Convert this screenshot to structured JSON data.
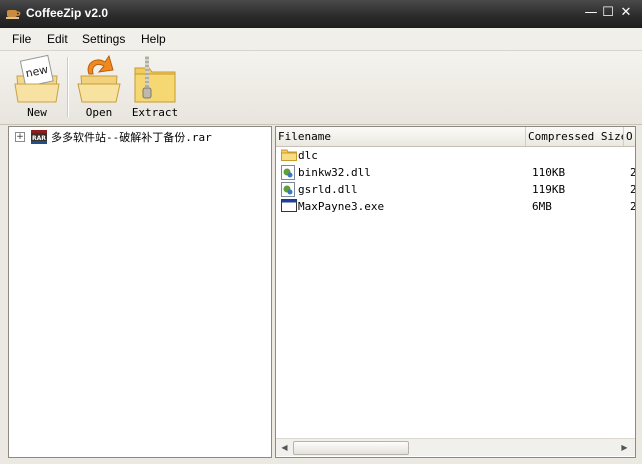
{
  "window": {
    "title": "CoffeeZip v2.0",
    "controls": {
      "minimize": "—",
      "maximize": "☐",
      "close": "✕"
    }
  },
  "menu": [
    "File",
    "Edit",
    "Settings",
    "Help"
  ],
  "toolbar": {
    "new_label": "New",
    "new_icon_text": "new",
    "open_label": "Open",
    "extract_label": "Extract"
  },
  "tree": {
    "expander": "+",
    "archive_icon_text": "RAR",
    "archive_name": "多多软件站--破解补丁备份.rar"
  },
  "list": {
    "columns": {
      "filename": "Filename",
      "compressed_size": "Compressed Size",
      "original": "O"
    },
    "rows": [
      {
        "name": "dlc",
        "size": "",
        "orig": "",
        "icon": "folder-icon"
      },
      {
        "name": "binkw32.dll",
        "size": "110KB",
        "orig": "2",
        "icon": "dll-file-icon"
      },
      {
        "name": "gsrld.dll",
        "size": "119KB",
        "orig": "2",
        "icon": "dll-file-icon"
      },
      {
        "name": "MaxPayne3.exe",
        "size": "6MB",
        "orig": "2",
        "icon": "exe-file-icon"
      }
    ]
  },
  "scrollbar": {
    "left_arrow": "◀",
    "right_arrow": "▶"
  },
  "colors": {
    "titlebar": "#2c2c2c",
    "folder": "#f2cc5a",
    "panel_bg": "#ece9e3"
  }
}
